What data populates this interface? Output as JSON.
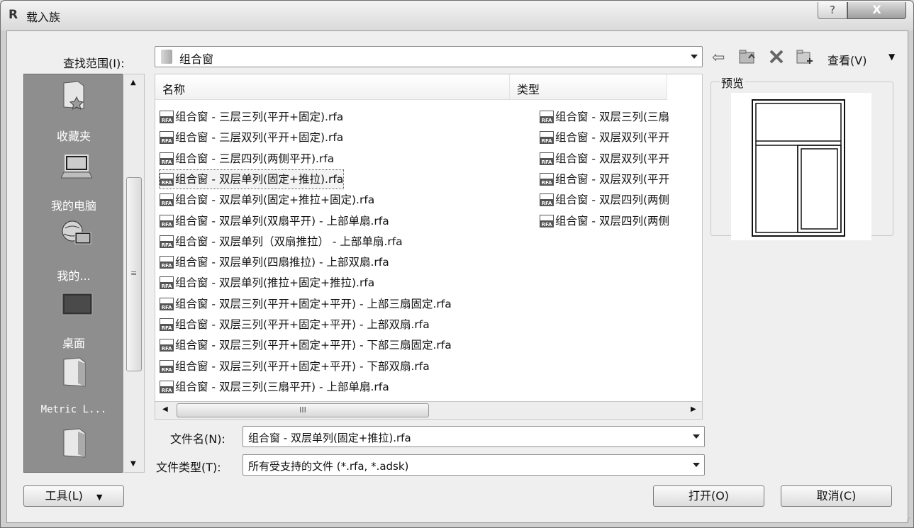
{
  "window": {
    "app_icon": "R",
    "title": "载入族",
    "help_glyph": "?",
    "close_glyph": "X"
  },
  "lookin": {
    "label": "查找范围(I):",
    "value": "组合窗"
  },
  "toolbar": {
    "view_label": "查看(V)",
    "view_arrow": "▼"
  },
  "places": [
    {
      "label": "收藏夹",
      "icon": "favorites-icon"
    },
    {
      "label": "我的电脑",
      "icon": "my-computer-icon"
    },
    {
      "label": "我的...",
      "icon": "my-network-icon"
    },
    {
      "label": "桌面",
      "icon": "desktop-icon"
    },
    {
      "label": "Metric L...",
      "icon": "folder-icon"
    },
    {
      "label": "",
      "icon": "folder-icon"
    }
  ],
  "columns": {
    "name": "名称",
    "type": "类型"
  },
  "files_left": [
    "组合窗 - 三层三列(平开+固定).rfa",
    "组合窗 - 三层双列(平开+固定).rfa",
    "组合窗 - 三层四列(两侧平开).rfa",
    "组合窗 - 双层单列(固定+推拉).rfa",
    "组合窗 - 双层单列(固定+推拉+固定).rfa",
    "组合窗 - 双层单列(双扇平开) - 上部单扇.rfa",
    "组合窗 - 双层单列（双扇推拉） - 上部单扇.rfa",
    "组合窗 - 双层单列(四扇推拉) - 上部双扇.rfa",
    "组合窗 - 双层单列(推拉+固定+推拉).rfa",
    "组合窗 - 双层三列(平开+固定+平开) - 上部三扇固定.rfa",
    "组合窗 - 双层三列(平开+固定+平开) - 上部双扇.rfa",
    "组合窗 - 双层三列(平开+固定+平开) - 下部三扇固定.rfa",
    "组合窗 - 双层三列(平开+固定+平开) - 下部双扇.rfa",
    "组合窗 - 双层三列(三扇平开) - 上部单扇.rfa"
  ],
  "files_right": [
    "组合窗 - 双层三列(三扇",
    "组合窗 - 双层双列(平开",
    "组合窗 - 双层双列(平开",
    "组合窗 - 双层双列(平开",
    "组合窗 - 双层四列(两侧",
    "组合窗 - 双层四列(两侧"
  ],
  "file_icon_text": "RFA",
  "selected_index": 3,
  "hscroll_grip": "III",
  "preview": {
    "label": "预览"
  },
  "filename": {
    "label": "文件名(N):",
    "value": "组合窗 - 双层单列(固定+推拉).rfa"
  },
  "filetype": {
    "label": "文件类型(T):",
    "value": "所有受支持的文件 (*.rfa, *.adsk)"
  },
  "buttons": {
    "tools": "工具(L)",
    "tools_arrow": "▼",
    "open": "打开(O)",
    "cancel": "取消(C)"
  }
}
